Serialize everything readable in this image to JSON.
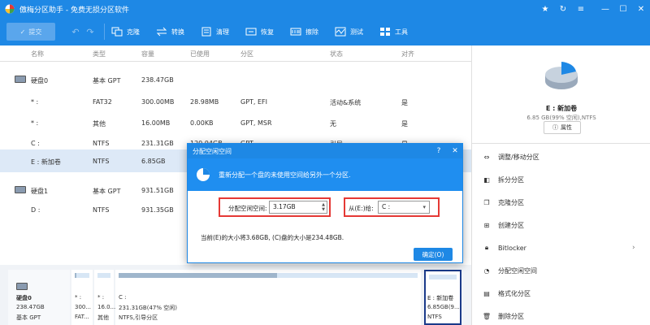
{
  "window": {
    "title": "傲梅分区助手 - 免费无损分区软件"
  },
  "toolbar": {
    "submit_label": "提交",
    "items": [
      "克隆",
      "转换",
      "清理",
      "恢复",
      "擦除",
      "测试",
      "工具"
    ]
  },
  "table": {
    "headers": [
      "名称",
      "类型",
      "容量",
      "已使用",
      "分区",
      "状态",
      "对齐"
    ],
    "disk0": {
      "name": "硬盘0",
      "type": "基本 GPT",
      "capacity": "238.47GB"
    },
    "disk0_rows": [
      {
        "name": "* :",
        "fs": "FAT32",
        "capacity": "300.00MB",
        "used": "28.98MB",
        "partition": "GPT, EFI",
        "status": "活动&系统",
        "aligned": "是"
      },
      {
        "name": "* :",
        "fs": "其他",
        "capacity": "16.00MB",
        "used": "0.00KB",
        "partition": "GPT, MSR",
        "status": "无",
        "aligned": "是"
      },
      {
        "name": "C :",
        "fs": "NTFS",
        "capacity": "231.31GB",
        "used": "120.94GB",
        "partition": "GPT",
        "status": "引导",
        "aligned": "是"
      },
      {
        "name": "E : 新加卷",
        "fs": "NTFS",
        "capacity": "6.85GB",
        "used": "",
        "partition": "",
        "status": "",
        "aligned": ""
      }
    ],
    "disk1": {
      "name": "硬盘1",
      "type": "基本 GPT",
      "capacity": "931.51GB"
    },
    "disk1_rows": [
      {
        "name": "D :",
        "fs": "NTFS",
        "capacity": "931.35GB"
      }
    ]
  },
  "right_panel": {
    "drive_name": "E : 新加卷",
    "drive_info": "6.85 GB(99% 空闲),NTFS",
    "properties_label": "属性",
    "operations": [
      "调整/移动分区",
      "拆分分区",
      "克隆分区",
      "创建分区",
      "Bitlocker",
      "分配空闲空间",
      "格式化分区",
      "删除分区"
    ]
  },
  "disk_map": {
    "disk_label": "硬盘0",
    "disk_size": "238.47GB",
    "disk_type": "基本 GPT",
    "blocks": [
      {
        "name": "* :",
        "size": "300...",
        "fs": "FAT..."
      },
      {
        "name": "* :",
        "size": "16.0...",
        "fs": "其他"
      },
      {
        "name": "C :",
        "size": "231.31GB(47% 空闲)",
        "fs": "NTFS,引导分区"
      },
      {
        "name": "E : 新加卷",
        "size": "6.85GB(9...",
        "fs": "NTFS"
      }
    ]
  },
  "dialog": {
    "title": "分配空闲空间",
    "help": "?",
    "close": "✕",
    "description": "重新分配一个盘的未使用空间给另外一个分区.",
    "free_space_label": "分配空闲空间:",
    "free_space_value": "3.17GB",
    "from_label": "从(E:)给:",
    "from_value": "C :",
    "info": "当前(E)的大小将3.68GB, (C)盘的大小是234.48GB.",
    "ok_label": "确定(O)"
  }
}
